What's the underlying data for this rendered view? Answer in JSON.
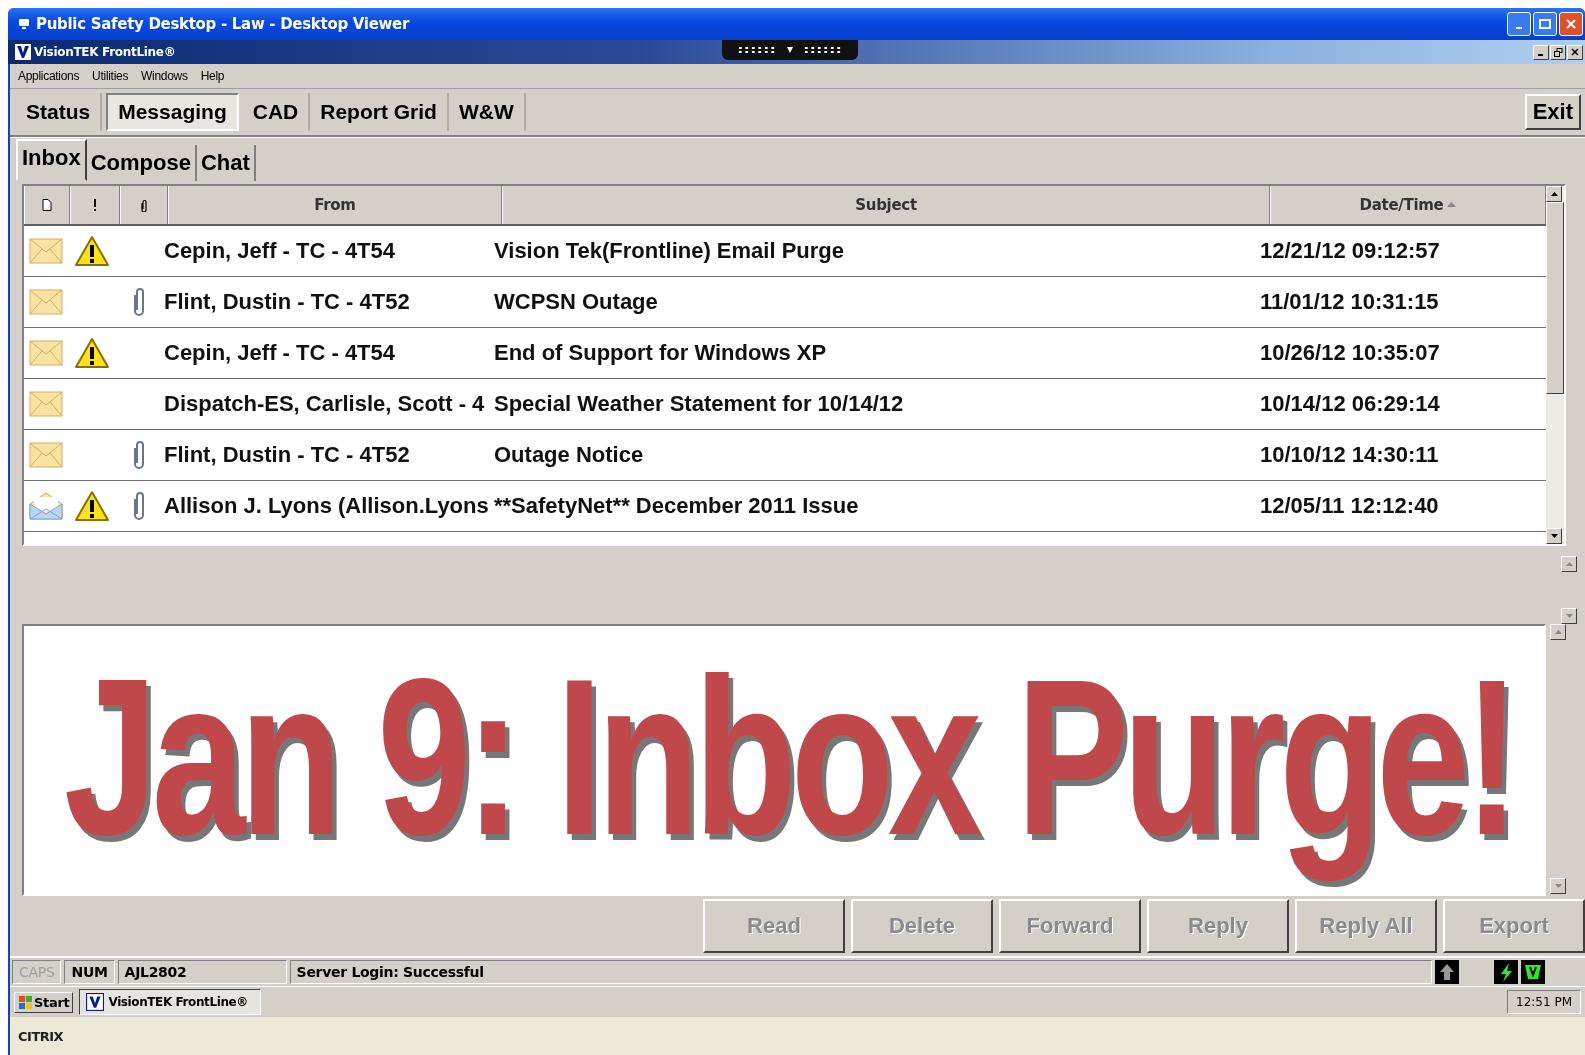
{
  "window": {
    "title": "Public Safety Desktop - Law - Desktop Viewer"
  },
  "app": {
    "title": "VisionTEK FrontLine®"
  },
  "menu": [
    "Applications",
    "Utilities",
    "Windows",
    "Help"
  ],
  "toolbar": {
    "tabs": [
      {
        "label": "Status",
        "selected": false
      },
      {
        "label": "Messaging",
        "selected": true
      },
      {
        "label": "CAD",
        "selected": false
      },
      {
        "label": "Report Grid",
        "selected": false
      },
      {
        "label": "W&W",
        "selected": false
      }
    ],
    "exit": "Exit"
  },
  "subtabs": [
    {
      "label": "Inbox",
      "selected": true
    },
    {
      "label": "Compose",
      "selected": false
    },
    {
      "label": "Chat",
      "selected": false
    }
  ],
  "table": {
    "columns": [
      "From",
      "Subject",
      "Date/Time"
    ],
    "rows": [
      {
        "read": false,
        "important": true,
        "attachment": false,
        "from": "Cepin, Jeff - TC - 4T54",
        "subject": "Vision Tek(Frontline) Email Purge",
        "date": "12/21/12 09:12:57"
      },
      {
        "read": false,
        "important": false,
        "attachment": true,
        "from": "Flint, Dustin - TC - 4T52",
        "subject": "WCPSN Outage",
        "date": "11/01/12 10:31:15"
      },
      {
        "read": false,
        "important": true,
        "attachment": false,
        "from": "Cepin, Jeff - TC - 4T54",
        "subject": "End of Support for Windows XP",
        "date": "10/26/12 10:35:07"
      },
      {
        "read": false,
        "important": false,
        "attachment": false,
        "from": "Dispatch-ES, Carlisle, Scott - 4",
        "subject": "Special Weather Statement for 10/14/12",
        "date": "10/14/12 06:29:14"
      },
      {
        "read": false,
        "important": false,
        "attachment": true,
        "from": "Flint, Dustin - TC - 4T52",
        "subject": "Outage Notice",
        "date": "10/10/12 14:30:11"
      },
      {
        "read": true,
        "important": true,
        "attachment": true,
        "from": "Allison J. Lyons (Allison.Lyons",
        "subject": "**SafetyNet** December 2011 Issue",
        "date": "12/05/11 12:12:40"
      }
    ]
  },
  "preview": {
    "text": "Jan 9: Inbox Purge!"
  },
  "buttons": [
    {
      "label": "Read",
      "disabled": true
    },
    {
      "label": "Delete",
      "disabled": true
    },
    {
      "label": "Forward",
      "disabled": true
    },
    {
      "label": "Reply",
      "disabled": true
    },
    {
      "label": "Reply All",
      "disabled": true
    },
    {
      "label": "Export",
      "disabled": true
    }
  ],
  "status_bar": {
    "indicators": [
      {
        "label": "CAPS",
        "on": false
      },
      {
        "label": "NUM",
        "on": true
      }
    ],
    "user": "AJL2802",
    "message": "Server Login: Successful"
  },
  "taskbar": {
    "start": "Start",
    "task": "VisionTEK FrontLine®",
    "clock": "12:51 PM"
  },
  "footer": "CITRIX"
}
